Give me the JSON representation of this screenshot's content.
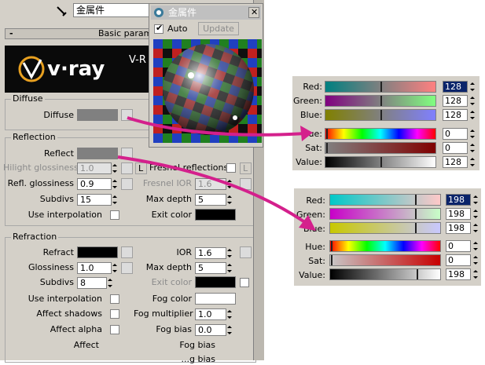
{
  "top_bar": {
    "material_name": "金属件"
  },
  "rollout": {
    "title": "Basic paramete"
  },
  "logo": {
    "brand_text": "v·ray",
    "side_text": "V-R"
  },
  "diffuse": {
    "group_label": "Diffuse",
    "diffuse_label": "Diffuse"
  },
  "reflection": {
    "group_label": "Reflection",
    "reflect_label": "Reflect",
    "hilight_gloss_label": "Hilight glossiness",
    "hilight_gloss_value": "1.0",
    "lock_label": "L",
    "fresnel_label": "Fresnel reflections",
    "fresnel_lock": "L",
    "refl_gloss_label": "Refl. glossiness",
    "refl_gloss_value": "0.9",
    "fresnel_ior_label": "Fresnel IOR",
    "fresnel_ior_value": "1.6",
    "subdivs_label": "Subdivs",
    "subdivs_value": "15",
    "max_depth_label": "Max depth",
    "max_depth_value": "5",
    "use_interp_label": "Use interpolation",
    "exit_color_label": "Exit color"
  },
  "refraction": {
    "group_label": "Refraction",
    "refract_label": "Refract",
    "ior_label": "IOR",
    "ior_value": "1.6",
    "gloss_label": "Glossiness",
    "gloss_value": "1.0",
    "max_depth_label": "Max depth",
    "max_depth_value": "5",
    "subdivs_label": "Subdivs",
    "subdivs_value": "8",
    "exit_color_label": "Exit color",
    "use_interp_label": "Use interpolation",
    "fog_color_label": "Fog color",
    "affect_shadows_label": "Affect shadows",
    "fog_mult_label": "Fog multiplier",
    "fog_mult_value": "1.0",
    "affect_alpha_label": "Affect alpha",
    "fog_bias_label": "Fog bias",
    "fog_bias_value": "0.0",
    "affect_label": "Affect",
    "fog_bias2_label": "Fog bias",
    "cut_label": "...g bias"
  },
  "preview": {
    "title": "金属件",
    "auto_label": "Auto",
    "update_label": "Update"
  },
  "picker1": {
    "red_label": "Red:",
    "red_value": "128",
    "green_label": "Green:",
    "green_value": "128",
    "blue_label": "Blue:",
    "blue_value": "128",
    "hue_label": "Hue:",
    "hue_value": "0",
    "sat_label": "Sat:",
    "sat_value": "0",
    "value_label": "Value:",
    "value_value": "128"
  },
  "picker2": {
    "red_label": "Red:",
    "red_value": "198",
    "green_label": "Green:",
    "green_value": "198",
    "blue_label": "Blue:",
    "blue_value": "198",
    "hue_label": "Hue:",
    "hue_value": "0",
    "sat_label": "Sat:",
    "sat_value": "0",
    "value_label": "Value:",
    "value_value": "198"
  },
  "colors": {
    "panel_bg": "#d4d0c8",
    "arrow": "#d4208c",
    "selection": "#0a246a"
  }
}
